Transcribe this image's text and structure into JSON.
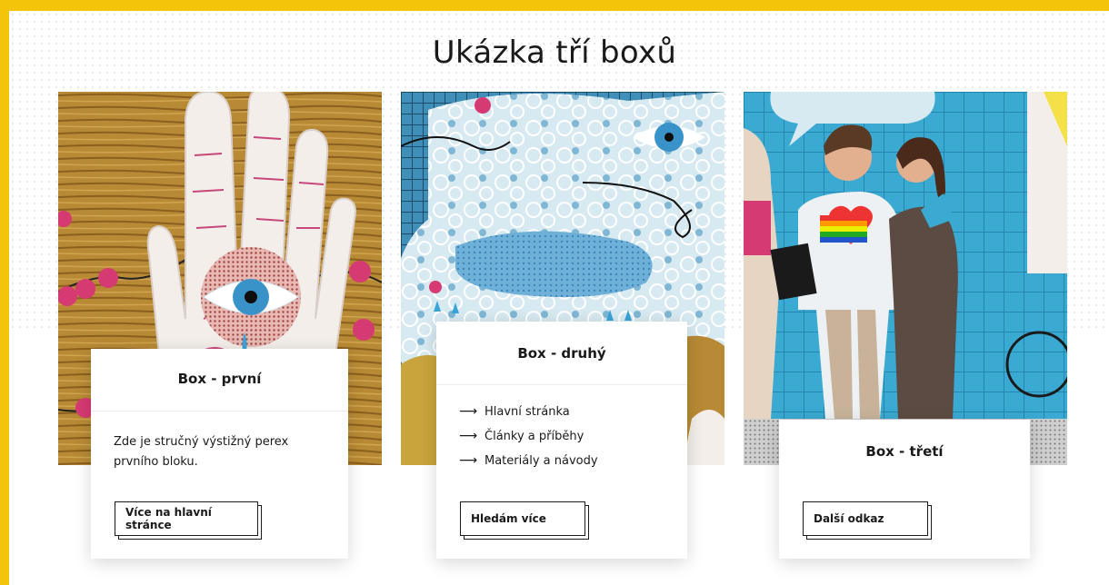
{
  "page": {
    "title": "Ukázka tří boxů",
    "accent_color": "#f4c40b"
  },
  "boxes": [
    {
      "title": "Box - první",
      "image": "illustration-hand-with-eye",
      "text": "Zde je stručný  výstižný perex prvního bloku.",
      "button_label": "Více na hlavní stránce"
    },
    {
      "title": "Box - druhý",
      "image": "illustration-eye-pattern",
      "links": [
        {
          "icon": "arrow-right-icon",
          "label": "Hlavní stránka"
        },
        {
          "icon": "arrow-right-icon",
          "label": "Články a příběhy"
        },
        {
          "icon": "arrow-right-icon",
          "label": "Materiály a návody"
        }
      ],
      "button_label": "Hledám více"
    },
    {
      "title": "Box - třetí",
      "image": "illustration-people-rainbow-heart",
      "button_label": "Další odkaz"
    }
  ]
}
